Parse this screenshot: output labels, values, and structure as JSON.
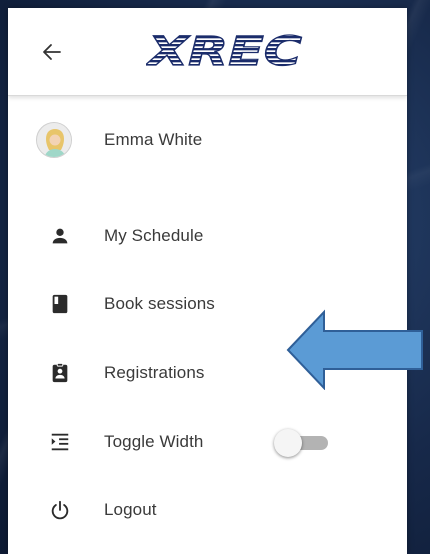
{
  "header": {
    "back_icon": "arrow-left-icon",
    "logo_text": "XREC"
  },
  "user": {
    "name": "Emma White",
    "avatar_icon": "user-avatar"
  },
  "menu": {
    "items": [
      {
        "label": "My Schedule",
        "icon": "person-icon"
      },
      {
        "label": "Book sessions",
        "icon": "book-icon"
      },
      {
        "label": "Registrations",
        "icon": "clipboard-person-icon"
      },
      {
        "label": "Toggle Width",
        "icon": "indent-icon"
      },
      {
        "label": "Logout",
        "icon": "power-icon"
      }
    ]
  },
  "toggle_width": {
    "on": false
  },
  "colors": {
    "logo_blue": "#1b2c6b",
    "arrow_fill": "#5b9bd5",
    "arrow_stroke": "#2f5f98",
    "text": "#3a3a3a",
    "icon": "#2b2b2b"
  }
}
